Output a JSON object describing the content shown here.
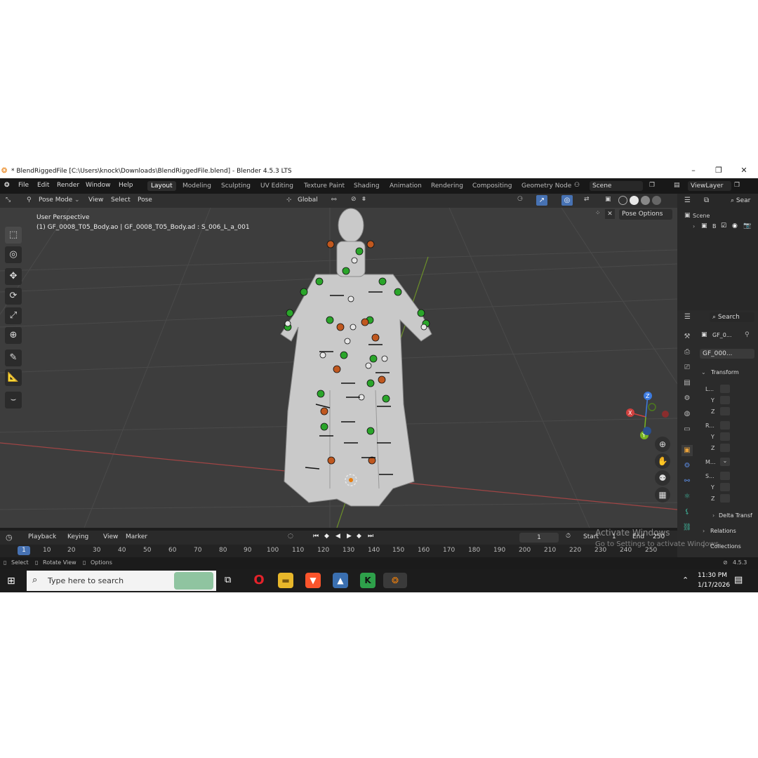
{
  "window": {
    "title": "* BlendRiggedFile [C:\\Users\\knock\\Downloads\\BlendRiggedFile.blend] - Blender 4.5.3 LTS",
    "minimize": "–",
    "maximize": "❐",
    "close": "✕"
  },
  "menu": {
    "items": [
      "File",
      "Edit",
      "Render",
      "Window",
      "Help"
    ]
  },
  "workspaces": {
    "tabs": [
      "Layout",
      "Modeling",
      "Sculpting",
      "UV Editing",
      "Texture Paint",
      "Shading",
      "Animation",
      "Rendering",
      "Compositing",
      "Geometry Node"
    ],
    "active": "Layout"
  },
  "scene": {
    "name": "Scene",
    "view_layer": "ViewLayer"
  },
  "viewport_header": {
    "mode": "Pose Mode",
    "menus": [
      "View",
      "Select",
      "Pose"
    ],
    "orientation": "Global",
    "pose_options": "Pose Options"
  },
  "viewport": {
    "view_name": "User Perspective",
    "object_info": "(1) GF_0008_T05_Body.ao | GF_0008_T05_Body.ad : S_006_L_a_001",
    "gizmo": {
      "x": "X",
      "y": "Y",
      "z": "Z"
    }
  },
  "outliner": {
    "search_placeholder": "Sear",
    "scene_label": "Scene",
    "collection_label": "B"
  },
  "properties": {
    "search_placeholder": "Search",
    "object_name": "GF_0...",
    "data_name": "GF_000...",
    "transform_label": "Transform",
    "rows": [
      "L...",
      "Y",
      "Z",
      "R...",
      "Y",
      "Z",
      "M...",
      "S...",
      "Y",
      "Z"
    ],
    "delta_label": "Delta Transf",
    "relations_label": "Relations",
    "collections_label": "Collections"
  },
  "timeline": {
    "menus": [
      "Playback",
      "Keying",
      "View",
      "Marker"
    ],
    "current_frame": "1",
    "start_label": "Start",
    "start": "1",
    "end_label": "End",
    "end": "250",
    "ruler": [
      "1",
      "10",
      "20",
      "30",
      "40",
      "50",
      "60",
      "70",
      "80",
      "90",
      "100",
      "110",
      "120",
      "130",
      "140",
      "150",
      "160",
      "170",
      "180",
      "190",
      "200",
      "210",
      "220",
      "230",
      "240",
      "250"
    ]
  },
  "status": {
    "items": [
      "Select",
      "Rotate View",
      "Options"
    ],
    "version": "4.5.3"
  },
  "watermark": {
    "line1": "Activate Windows",
    "line2": "Go to Settings to activate Windows."
  },
  "taskbar": {
    "search_placeholder": "Type here to search",
    "time": "11:30 PM",
    "date": "1/17/2026"
  },
  "colors": {
    "accent": "#4772b3",
    "blender_orange": "#e87d0d",
    "bone_green": "#2aa52a",
    "bone_orange": "#c0581f",
    "x_axis": "#d0413f",
    "y_axis": "#78b421",
    "z_axis": "#3d7be0"
  }
}
